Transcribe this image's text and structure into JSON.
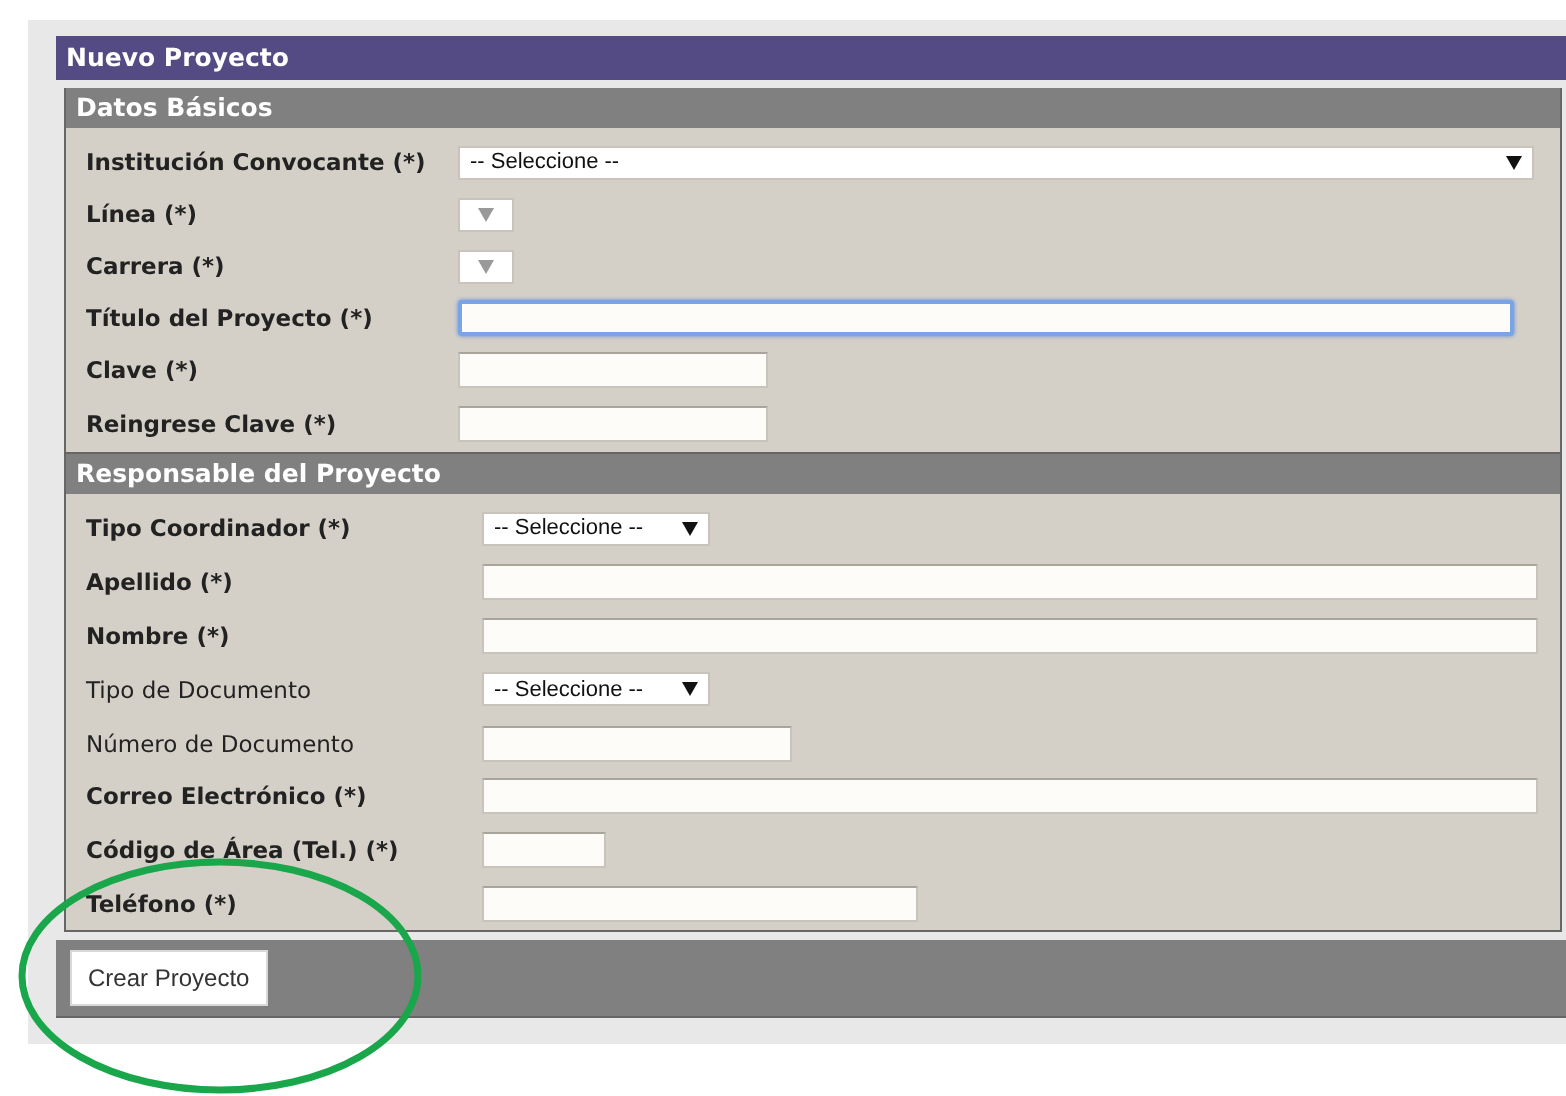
{
  "title": "Nuevo Proyecto",
  "sections": [
    {
      "title": "Datos Básicos",
      "fields": [
        {
          "label": "Institución Convocante (*)",
          "bold": true,
          "kind": "wideselect",
          "value": "-- Seleccione --"
        },
        {
          "label": "Línea (*)",
          "bold": true,
          "kind": "stubselect"
        },
        {
          "label": "Carrera (*)",
          "bold": true,
          "kind": "stubselect"
        },
        {
          "label": "Título del Proyecto (*)",
          "bold": true,
          "kind": "widetext",
          "focused": true
        },
        {
          "label": "Clave (*)",
          "bold": true,
          "kind": "midtext",
          "focused": false
        },
        {
          "label": "Reingrese Clave (*)",
          "bold": true,
          "kind": "midtext",
          "focused": false
        }
      ]
    },
    {
      "title": "Responsable del Proyecto",
      "fields": [
        {
          "label": "Tipo Coordinador (*)",
          "bold": true,
          "kind": "shortselect",
          "value": "-- Seleccione --"
        },
        {
          "label": "Apellido (*)",
          "bold": true,
          "kind": "widetext",
          "focused": false
        },
        {
          "label": "Nombre (*)",
          "bold": true,
          "kind": "widetext",
          "focused": false
        },
        {
          "label": "Tipo de Documento",
          "bold": false,
          "kind": "shortselect",
          "value": "-- Seleccione --"
        },
        {
          "label": "Número de Documento",
          "bold": false,
          "kind": "midtext",
          "focused": false
        },
        {
          "label": "Correo Electrónico (*)",
          "bold": true,
          "kind": "widetext",
          "focused": false
        },
        {
          "label": "Código de Área (Tel.) (*)",
          "bold": true,
          "kind": "tinytext",
          "focused": false
        },
        {
          "label": "Teléfono (*)",
          "bold": true,
          "kind": "longtext",
          "focused": false
        }
      ]
    }
  ],
  "submit": "Crear Proyecto",
  "annotation": {
    "kind": "ellipse",
    "color": "#1aa64a"
  }
}
